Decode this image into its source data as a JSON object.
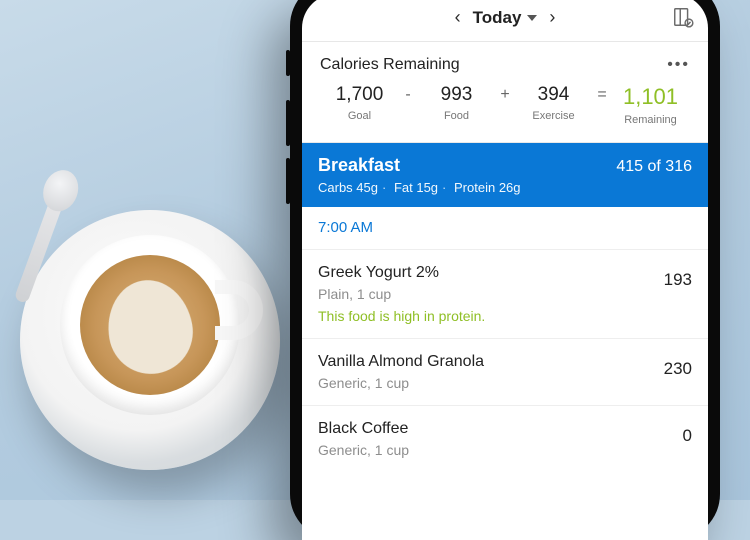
{
  "colors": {
    "brand_blue": "#0a78d6",
    "accent_green": "#8fbf26"
  },
  "nav": {
    "title": "Today"
  },
  "calories": {
    "title": "Calories Remaining",
    "goal": {
      "value": "1,700",
      "label": "Goal"
    },
    "food": {
      "value": "993",
      "label": "Food"
    },
    "exercise": {
      "value": "394",
      "label": "Exercise"
    },
    "remaining": {
      "value": "1,101",
      "label": "Remaining"
    }
  },
  "meal": {
    "name": "Breakfast",
    "cals_text": "415 of 316",
    "macros": {
      "carbs": "Carbs 45g",
      "fat": "Fat 15g",
      "protein": "Protein 26g"
    },
    "time": "7:00 AM"
  },
  "foods": [
    {
      "name": "Greek Yogurt 2%",
      "sub": "Plain, 1 cup",
      "note": "This food is high in protein.",
      "cal": "193"
    },
    {
      "name": "Vanilla Almond Granola",
      "sub": "Generic, 1 cup",
      "note": "",
      "cal": "230"
    },
    {
      "name": "Black Coffee",
      "sub": "Generic, 1 cup",
      "note": "",
      "cal": "0"
    }
  ]
}
